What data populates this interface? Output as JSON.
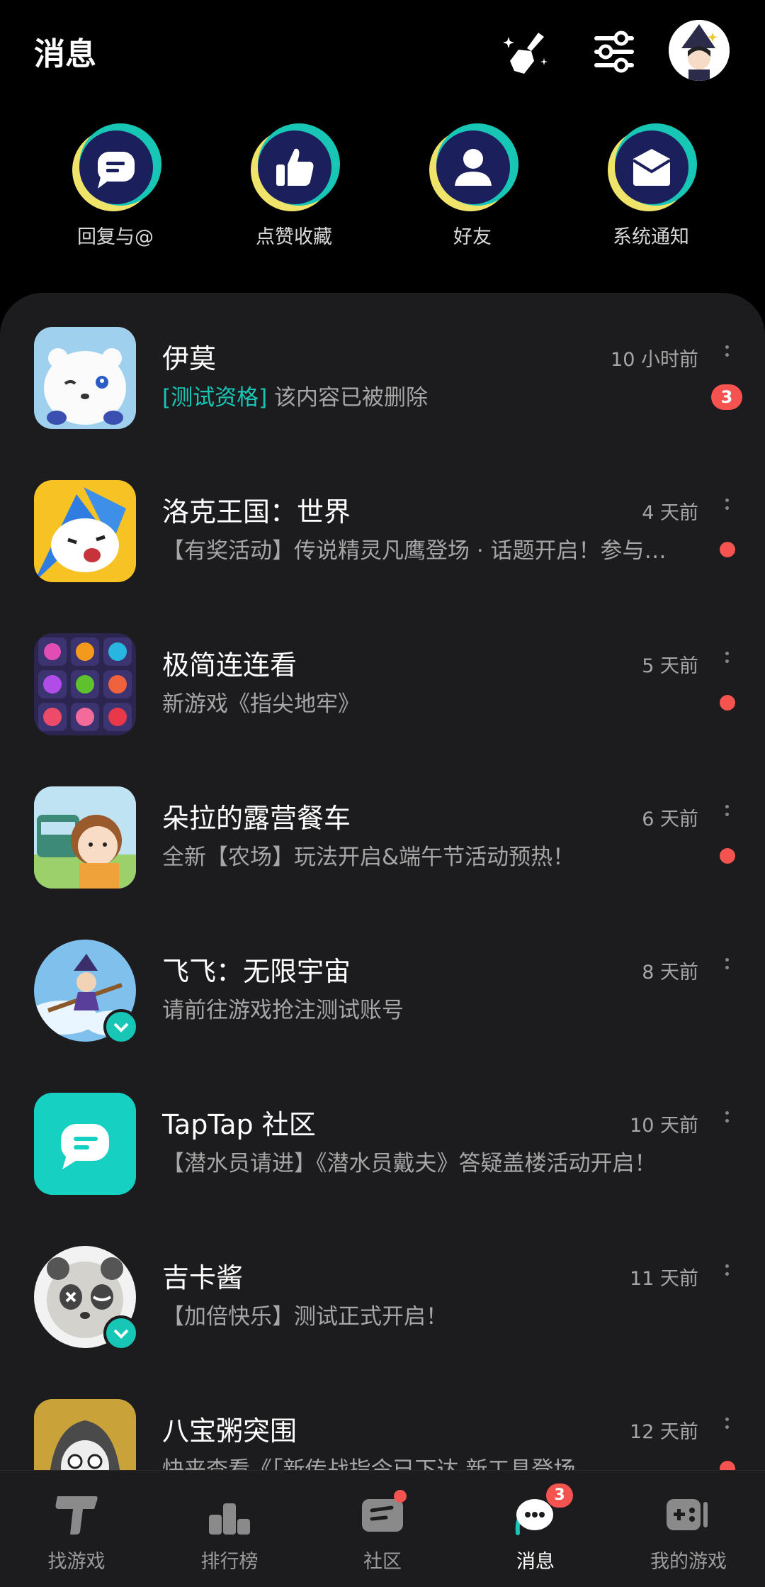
{
  "header": {
    "title": "消息"
  },
  "quick_actions": [
    {
      "label": "回复与@",
      "icon": "comment-icon"
    },
    {
      "label": "点赞收藏",
      "icon": "thumbs-up-icon"
    },
    {
      "label": "好友",
      "icon": "person-icon"
    },
    {
      "label": "系统通知",
      "icon": "envelope-icon"
    }
  ],
  "messages": [
    {
      "name": "伊莫",
      "tag": "[测试资格]",
      "preview": " 该内容已被删除",
      "time": "10 小时前",
      "badge": "3"
    },
    {
      "name": "洛克王国：世界",
      "tag": "",
      "preview": "【有奖活动】传说精灵凡鹰登场 · 话题开启！参与讨论赢好礼",
      "time": "4 天前"
    },
    {
      "name": "极简连连看",
      "tag": "",
      "preview": "新游戏《指尖地牢》",
      "time": "5 天前"
    },
    {
      "name": "朵拉的露营餐车",
      "tag": "",
      "preview": "全新【农场】玩法开启&端午节活动预热！",
      "time": "6 天前"
    },
    {
      "name": "飞飞：无限宇宙",
      "tag": "",
      "preview": "请前往游戏抢注测试账号",
      "time": "8 天前"
    },
    {
      "name": "TapTap 社区",
      "tag": "",
      "preview": "【潜水员请进】《潜水员戴夫》答疑盖楼活动开启！",
      "time": "10 天前"
    },
    {
      "name": "吉卡酱",
      "tag": "",
      "preview": "【加倍快乐】测试正式开启！",
      "time": "11 天前"
    },
    {
      "name": "八宝粥突围",
      "tag": "",
      "preview": "快来查看《「新传战指令已下达 新工具登场",
      "time": "12 天前"
    }
  ],
  "tabs": [
    {
      "label": "找游戏"
    },
    {
      "label": "排行榜"
    },
    {
      "label": "社区"
    },
    {
      "label": "消息",
      "badge": "3"
    },
    {
      "label": "我的游戏"
    }
  ],
  "colors": {
    "accent": "#17c6b5",
    "badge": "#f5534f",
    "panel": "#1c1c1e",
    "icon_navy": "#1b1f5c"
  }
}
